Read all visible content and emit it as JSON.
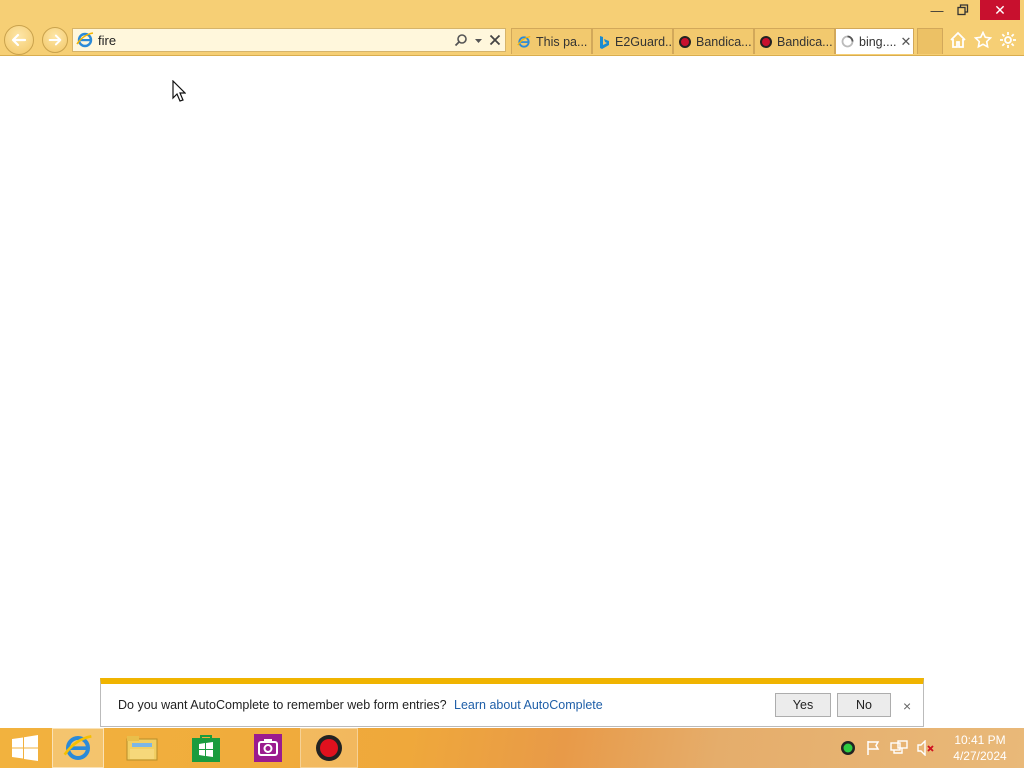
{
  "browser": {
    "address_value": "fire",
    "tabs": [
      {
        "label": "This pa...",
        "icon": "ie-icon",
        "active": false
      },
      {
        "label": "E2Guard...",
        "icon": "bing-icon",
        "active": false
      },
      {
        "label": "Bandica...",
        "icon": "bandicam-icon",
        "active": false
      },
      {
        "label": "Bandica...",
        "icon": "bandicam-icon",
        "active": false
      },
      {
        "label": "bing....",
        "icon": "loading-icon",
        "active": true
      }
    ],
    "window_controls": {
      "minimize": "—",
      "maximize": "❐",
      "close": "✕"
    },
    "tab_close": "✕"
  },
  "notification": {
    "message": "Do you want AutoComplete to remember web form entries?",
    "link": "Learn about AutoComplete",
    "yes_label": "Yes",
    "no_label": "No",
    "close": "×"
  },
  "taskbar": {
    "time": "10:41 PM",
    "date": "4/27/2024",
    "apps": [
      "start-icon",
      "internet-explorer-icon",
      "file-explorer-icon",
      "store-icon",
      "camera-icon",
      "bandicam-icon"
    ],
    "tray": [
      "bandicam-tray-icon",
      "action-center-flag-icon",
      "network-icon",
      "volume-muted-icon"
    ]
  },
  "colors": {
    "chrome_bg": "#f6cf75",
    "accent": "#f0b400",
    "close_red": "#c8102e",
    "link": "#1f5fa8"
  }
}
